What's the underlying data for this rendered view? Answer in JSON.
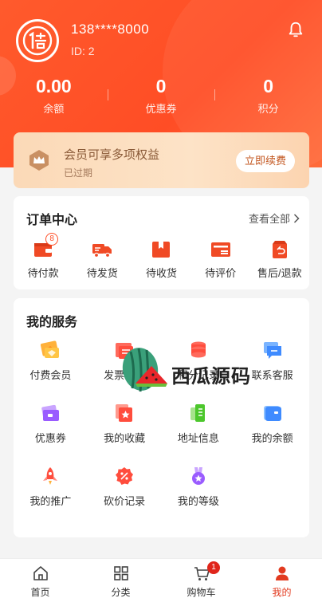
{
  "profile": {
    "phone": "138****8000",
    "id_label": "ID: 2"
  },
  "stats": [
    {
      "value": "0.00",
      "label": "余额"
    },
    {
      "value": "0",
      "label": "优惠券"
    },
    {
      "value": "0",
      "label": "积分"
    }
  ],
  "vip": {
    "title": "会员可享多项权益",
    "status": "已过期",
    "button": "立即续费"
  },
  "orders": {
    "title": "订单中心",
    "see_all": "查看全部",
    "items": [
      {
        "label": "待付款",
        "badge": "8",
        "icon": "wallet-icon"
      },
      {
        "label": "待发货",
        "icon": "truck-icon"
      },
      {
        "label": "待收货",
        "icon": "box-icon"
      },
      {
        "label": "待评价",
        "icon": "review-icon"
      },
      {
        "label": "售后/退款",
        "icon": "refund-icon"
      }
    ]
  },
  "services": {
    "title": "我的服务",
    "items": [
      {
        "label": "付费会员",
        "icon": "diamond-icon"
      },
      {
        "label": "发票管理",
        "icon": "invoice-icon"
      },
      {
        "label": "积分记录",
        "icon": "coin-stack-icon"
      },
      {
        "label": "联系客服",
        "icon": "chat-icon"
      },
      {
        "label": "优惠券",
        "icon": "coupon-icon"
      },
      {
        "label": "我的收藏",
        "icon": "star-icon"
      },
      {
        "label": "地址信息",
        "icon": "address-icon"
      },
      {
        "label": "我的余额",
        "icon": "balance-icon"
      },
      {
        "label": "我的推广",
        "icon": "rocket-icon"
      },
      {
        "label": "砍价记录",
        "icon": "discount-icon"
      },
      {
        "label": "我的等级",
        "icon": "medal-icon"
      }
    ]
  },
  "watermark": {
    "text": "西瓜源码"
  },
  "tabbar": {
    "items": [
      {
        "label": "首页",
        "icon": "home-icon"
      },
      {
        "label": "分类",
        "icon": "grid-icon"
      },
      {
        "label": "购物车",
        "icon": "cart-icon",
        "badge": "1"
      },
      {
        "label": "我的",
        "icon": "user-icon",
        "active": true
      }
    ]
  },
  "colors": {
    "primary": "#ff4d25",
    "active_tab": "#e23a1f",
    "vip_text": "#8a5a38"
  }
}
